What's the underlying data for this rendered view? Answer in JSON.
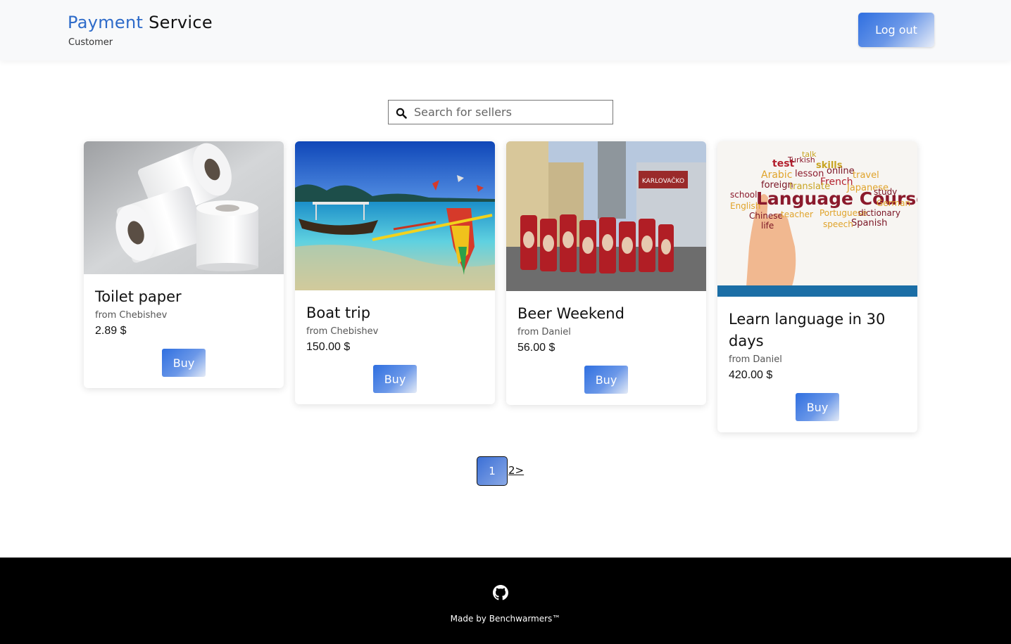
{
  "header": {
    "brand_accent": "Payment",
    "brand_rest": " Service",
    "subtitle": "Customer",
    "logout_label": "Log out"
  },
  "search": {
    "placeholder": "Search for sellers",
    "icon": "search-icon"
  },
  "products": [
    {
      "title": "Toilet paper",
      "seller": "from Chebishev",
      "price": "2.89 $",
      "buy_label": "Buy"
    },
    {
      "title": "Boat trip",
      "seller": "from Chebishev",
      "price": "150.00 $",
      "buy_label": "Buy"
    },
    {
      "title": "Beer Weekend",
      "seller": "from Daniel",
      "price": "56.00 $",
      "buy_label": "Buy"
    },
    {
      "title": "Learn language in 30 days",
      "seller": "from Daniel",
      "price": "420.00 $",
      "buy_label": "Buy"
    }
  ],
  "pagination": {
    "current": "1",
    "next": "2>"
  },
  "footer": {
    "icon": "github-icon",
    "made_by": "Made by Benchwarmers™"
  },
  "colors": {
    "brand_accent": "#2e6bc9",
    "button_gradient_start": "#2f6fe0",
    "footer_bg": "#000000"
  },
  "image_text": {
    "beer_sign": "KARLOVAČKO",
    "word_cloud": [
      "Language Courses",
      "test",
      "skills",
      "Arabic",
      "lesson",
      "online",
      "French",
      "foreign",
      "translate",
      "Japanese",
      "travel",
      "study",
      "school",
      "English",
      "Portuguese",
      "dictionary",
      "German",
      "Chinese",
      "teacher",
      "Spanish",
      "speech",
      "life",
      "Turkish",
      "talk"
    ]
  }
}
